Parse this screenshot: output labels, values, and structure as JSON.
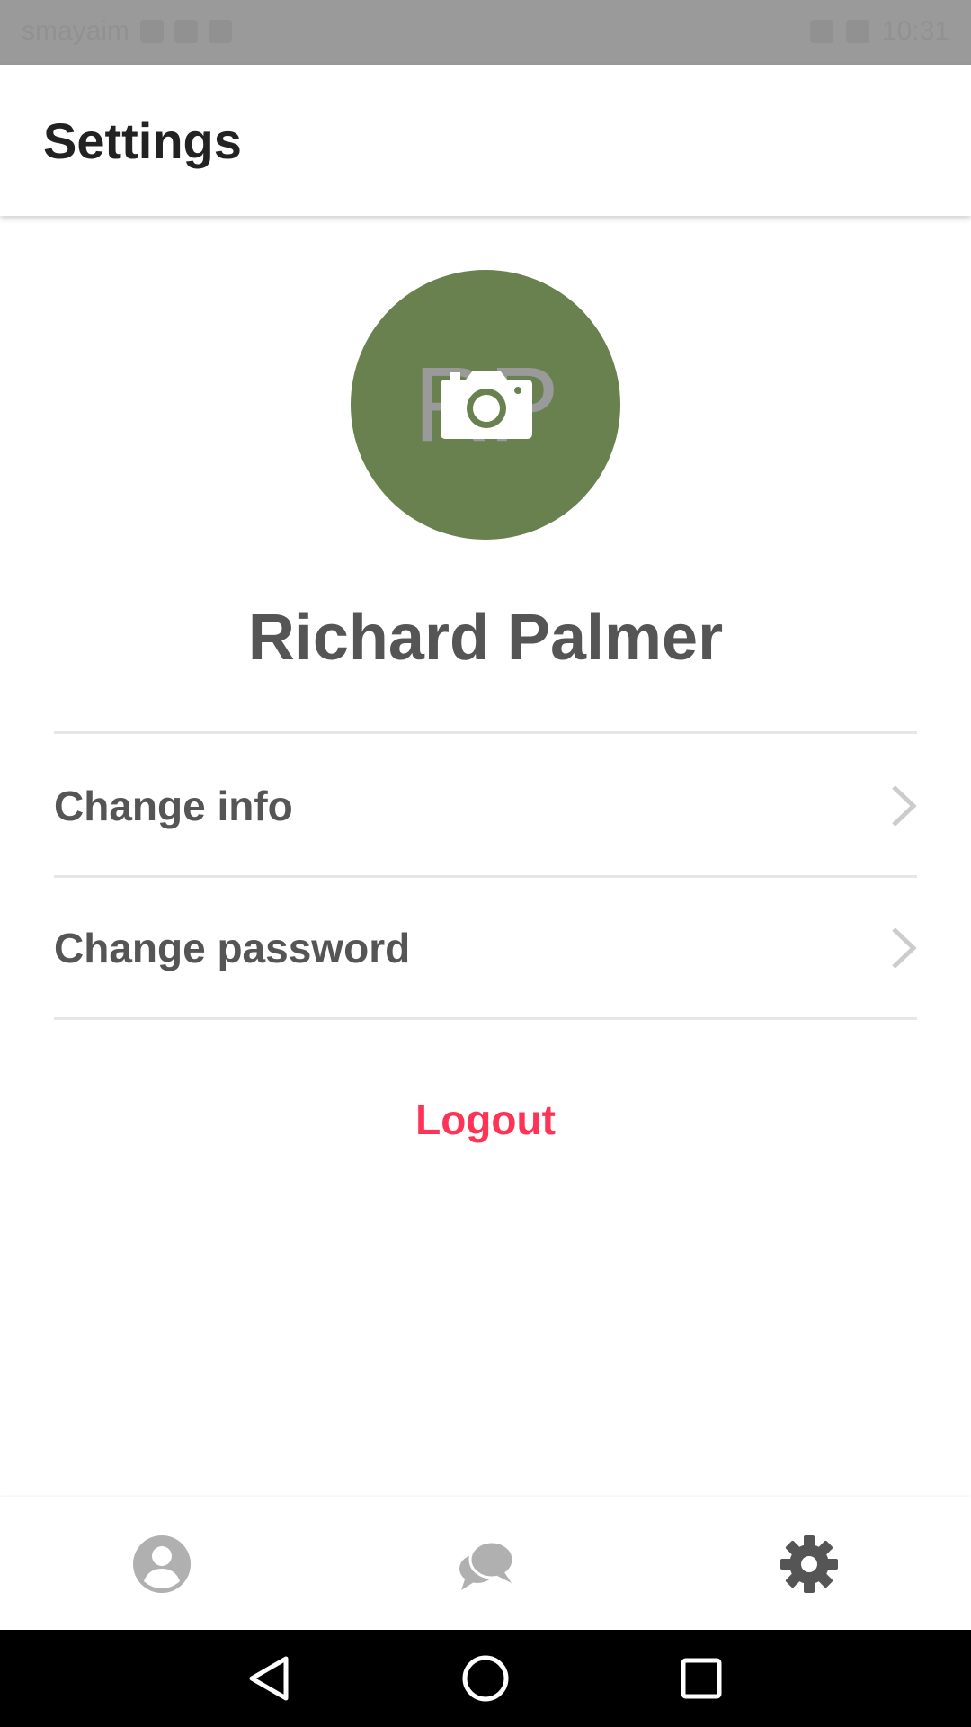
{
  "status_bar": {
    "left_text": "smayaim",
    "time": "10:31"
  },
  "header": {
    "title": "Settings"
  },
  "profile": {
    "initials": "RP",
    "name": "Richard Palmer",
    "avatar_color": "#69804f"
  },
  "menu": {
    "items": [
      {
        "label": "Change info",
        "icon": "chevron-right-icon"
      },
      {
        "label": "Change password",
        "icon": "chevron-right-icon"
      }
    ]
  },
  "logout": {
    "label": "Logout",
    "color": "#ff3355"
  },
  "tab_bar": {
    "tabs": [
      {
        "icon": "profile-icon",
        "active": false
      },
      {
        "icon": "chat-icon",
        "active": false
      },
      {
        "icon": "settings-gear-icon",
        "active": true
      }
    ],
    "active_color": "#555555",
    "inactive_color": "#b0b0b0"
  },
  "nav_bar": {
    "buttons": [
      "back-icon",
      "home-icon",
      "recents-icon"
    ]
  }
}
